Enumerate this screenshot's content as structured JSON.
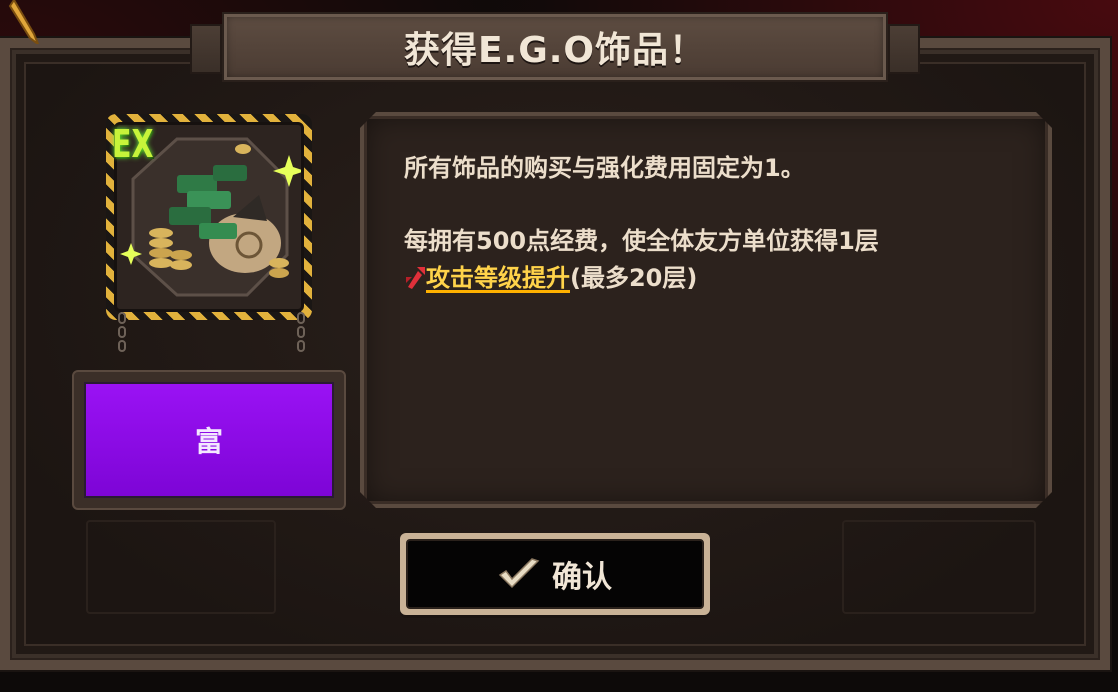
{
  "dialog": {
    "title": "获得E.G.O饰品！"
  },
  "item": {
    "badge": "EX",
    "icon": "money-bag-icon",
    "tier_label": "富",
    "tier_color": "#8a0ae6"
  },
  "description": {
    "line1": "所有饰品的购买与强化费用固定为1。",
    "line2": "每拥有500点经费，使全体友方单位获得1层",
    "keyword": "攻击等级提升",
    "keyword_icon": "attack-up-icon",
    "suffix": "(最多20层)"
  },
  "confirm": {
    "label": "确认",
    "icon": "checkmark-icon"
  },
  "colors": {
    "keyword": "#ffd34a",
    "accent_gold": "#e2b23c",
    "ex_green": "#c7f43a"
  }
}
